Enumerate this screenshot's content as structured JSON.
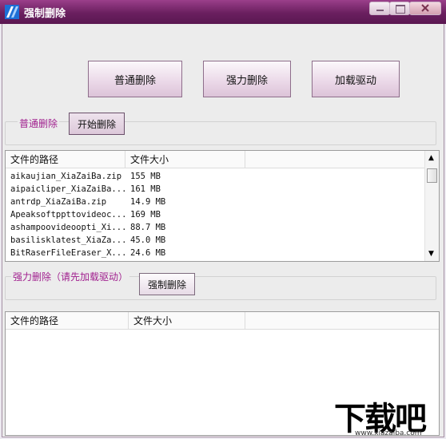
{
  "window": {
    "title": "强制删除"
  },
  "toolbar": {
    "normal_delete": "普通删除",
    "force_delete": "强力删除",
    "load_driver": "加载驱动"
  },
  "normal_section": {
    "label": "普通删除",
    "start_button": "开始删除",
    "columns": [
      "文件的路径",
      "文件大小"
    ],
    "rows": [
      {
        "path": "aikaujian_XiaZaiBa.zip",
        "size": "155 MB"
      },
      {
        "path": "aipaicliper_XiaZaiBa...",
        "size": "161 MB"
      },
      {
        "path": "antrdp_XiaZaiBa.zip",
        "size": "14.9 MB"
      },
      {
        "path": "Apeaksoftppttovideoc...",
        "size": "169 MB"
      },
      {
        "path": "ashampoovideoopti_Xi...",
        "size": "88.7 MB"
      },
      {
        "path": "basilisklatest_XiaZa...",
        "size": "45.0 MB"
      },
      {
        "path": "BitRaserFileEraser_X...",
        "size": "24.6 MB"
      }
    ]
  },
  "force_section": {
    "label": "强力删除（请先加载驱动）",
    "button": "强制删除",
    "columns": [
      "文件的路径",
      "文件大小"
    ]
  },
  "watermark": {
    "logo": "下载吧",
    "url": "www.xiazaiba.com"
  }
}
